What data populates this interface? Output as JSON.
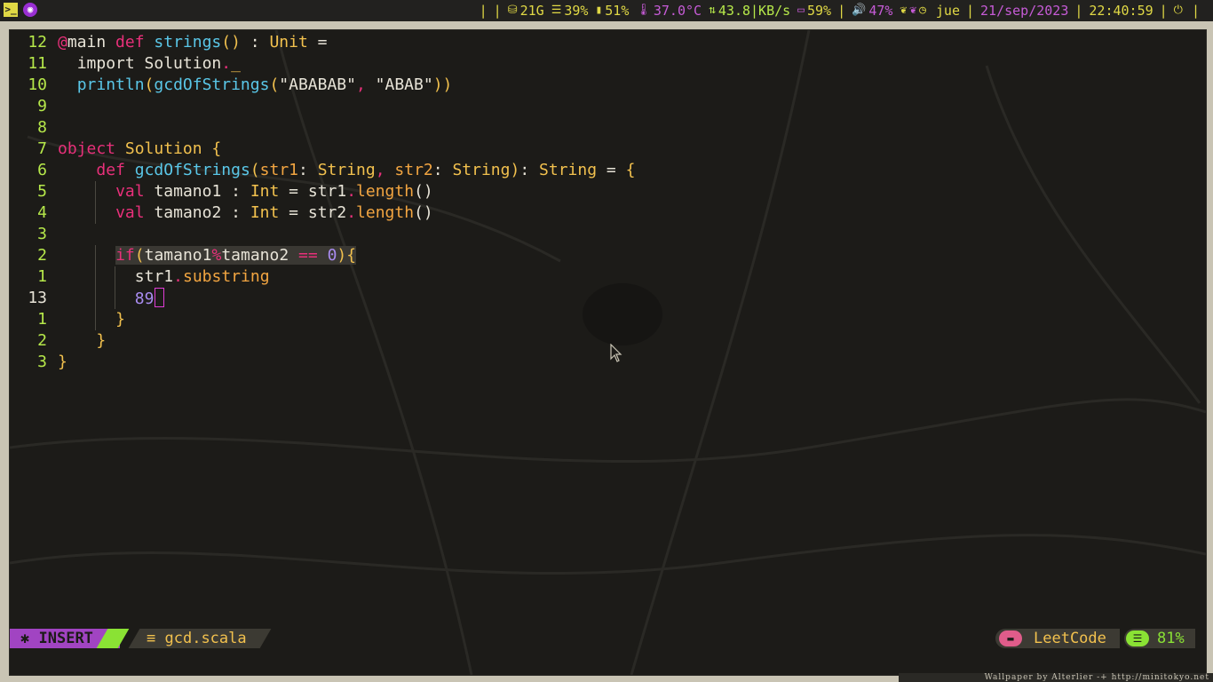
{
  "topbar": {
    "disk": "21G",
    "memory": "39%",
    "battery_like": "51%",
    "temperature": "37.0°C",
    "network": "43.8|KB/s",
    "battery": "59%",
    "volume": "47%",
    "day": "jue",
    "date": "21/sep/2023",
    "time": "22:40:59",
    "icons": [
      "terminal-icon",
      "workspace-icon",
      "disk-icon",
      "memory-icon",
      "battery-small-icon",
      "thermometer-icon",
      "network-icon",
      "battery-icon",
      "volume-icon",
      "leaf-icon",
      "leaf-icon-2",
      "clock-icon",
      "power-icon"
    ]
  },
  "editor": {
    "lines": [
      {
        "num": "12",
        "current": false,
        "indent": 0,
        "tokens": [
          [
            "t-an",
            "@"
          ],
          [
            "t-df",
            "main "
          ],
          [
            "t-kw",
            "def "
          ],
          [
            "t-fn",
            "strings"
          ],
          [
            "t-pn",
            "()"
          ],
          [
            "t-df",
            " : "
          ],
          [
            "t-ty",
            "Unit"
          ],
          [
            "t-df",
            " ="
          ]
        ]
      },
      {
        "num": "11",
        "current": false,
        "indent": 1,
        "tokens": [
          [
            "t-df",
            "import Solution"
          ],
          [
            "t-op",
            "."
          ],
          [
            "t-ty",
            "_"
          ]
        ]
      },
      {
        "num": "10",
        "current": false,
        "indent": 1,
        "tokens": [
          [
            "t-fn",
            "println"
          ],
          [
            "t-pn",
            "("
          ],
          [
            "t-fn",
            "gcdOfStrings"
          ],
          [
            "t-pn",
            "("
          ],
          [
            "t-st",
            "\"ABABAB\""
          ],
          [
            "t-op",
            ", "
          ],
          [
            "t-st",
            "\"ABAB\""
          ],
          [
            "t-pn",
            "))"
          ]
        ]
      },
      {
        "num": "9",
        "current": false,
        "indent": 0,
        "tokens": []
      },
      {
        "num": "8",
        "current": false,
        "indent": 0,
        "tokens": []
      },
      {
        "num": "7",
        "current": false,
        "indent": 0,
        "tokens": [
          [
            "t-kw",
            "object "
          ],
          [
            "t-ty",
            "Solution"
          ],
          [
            "t-pn",
            " {"
          ]
        ]
      },
      {
        "num": "6",
        "current": false,
        "indent": 2,
        "tokens": [
          [
            "t-kw",
            "def "
          ],
          [
            "t-fn",
            "gcdOfStrings"
          ],
          [
            "t-pn",
            "("
          ],
          [
            "t-pa",
            "str1"
          ],
          [
            "t-df",
            ": "
          ],
          [
            "t-ty",
            "String"
          ],
          [
            "t-op",
            ", "
          ],
          [
            "t-pa",
            "str2"
          ],
          [
            "t-df",
            ": "
          ],
          [
            "t-ty",
            "String"
          ],
          [
            "t-pn",
            ")"
          ],
          [
            "t-df",
            ": "
          ],
          [
            "t-ty",
            "String"
          ],
          [
            "t-df",
            " = "
          ],
          [
            "t-pn",
            "{"
          ]
        ]
      },
      {
        "num": "5",
        "current": false,
        "indent": 3,
        "tokens": [
          [
            "t-kw",
            "val "
          ],
          [
            "t-df",
            "tamano1 : "
          ],
          [
            "t-ty",
            "Int"
          ],
          [
            "t-df",
            " = str1"
          ],
          [
            "t-op",
            "."
          ],
          [
            "t-mt",
            "length"
          ],
          [
            "t-df",
            "()"
          ]
        ]
      },
      {
        "num": "4",
        "current": false,
        "indent": 3,
        "tokens": [
          [
            "t-kw",
            "val "
          ],
          [
            "t-df",
            "tamano2 : "
          ],
          [
            "t-ty",
            "Int"
          ],
          [
            "t-df",
            " = str2"
          ],
          [
            "t-op",
            "."
          ],
          [
            "t-mt",
            "length"
          ],
          [
            "t-df",
            "()"
          ]
        ]
      },
      {
        "num": "3",
        "current": false,
        "indent": 0,
        "tokens": []
      },
      {
        "num": "2",
        "current": false,
        "indent": 3,
        "highlight": true,
        "tokens": [
          [
            "t-kw",
            "if"
          ],
          [
            "t-pn",
            "("
          ],
          [
            "t-df",
            "tamano1"
          ],
          [
            "t-op",
            "%"
          ],
          [
            "t-df",
            "tamano2 "
          ],
          [
            "t-op",
            "=="
          ],
          [
            "t-df",
            " "
          ],
          [
            "t-nm",
            "0"
          ],
          [
            "t-pn",
            "){"
          ]
        ]
      },
      {
        "num": "1",
        "current": false,
        "indent": 4,
        "tokens": [
          [
            "t-df",
            "str1"
          ],
          [
            "t-op",
            "."
          ],
          [
            "t-mt",
            "substring"
          ]
        ]
      },
      {
        "num": "13",
        "current": true,
        "indent": 4,
        "cursor": true,
        "tokens": [
          [
            "t-nm",
            "89"
          ]
        ]
      },
      {
        "num": "1",
        "current": false,
        "indent": 3,
        "tokens": [
          [
            "t-pn",
            "}"
          ]
        ]
      },
      {
        "num": "2",
        "current": false,
        "indent": 2,
        "tokens": [
          [
            "t-pn",
            "}"
          ]
        ]
      },
      {
        "num": "3",
        "current": false,
        "indent": 0,
        "tokens": [
          [
            "t-pn",
            "}"
          ]
        ]
      }
    ]
  },
  "statusline": {
    "mode": "INSERT",
    "mode_icon": "✱",
    "file_icon": "≡",
    "filename": "gcd.scala",
    "project": "LeetCode",
    "percent": "81%"
  },
  "credit": "Wallpaper by Alterlier -+ http://minitokyo.net"
}
